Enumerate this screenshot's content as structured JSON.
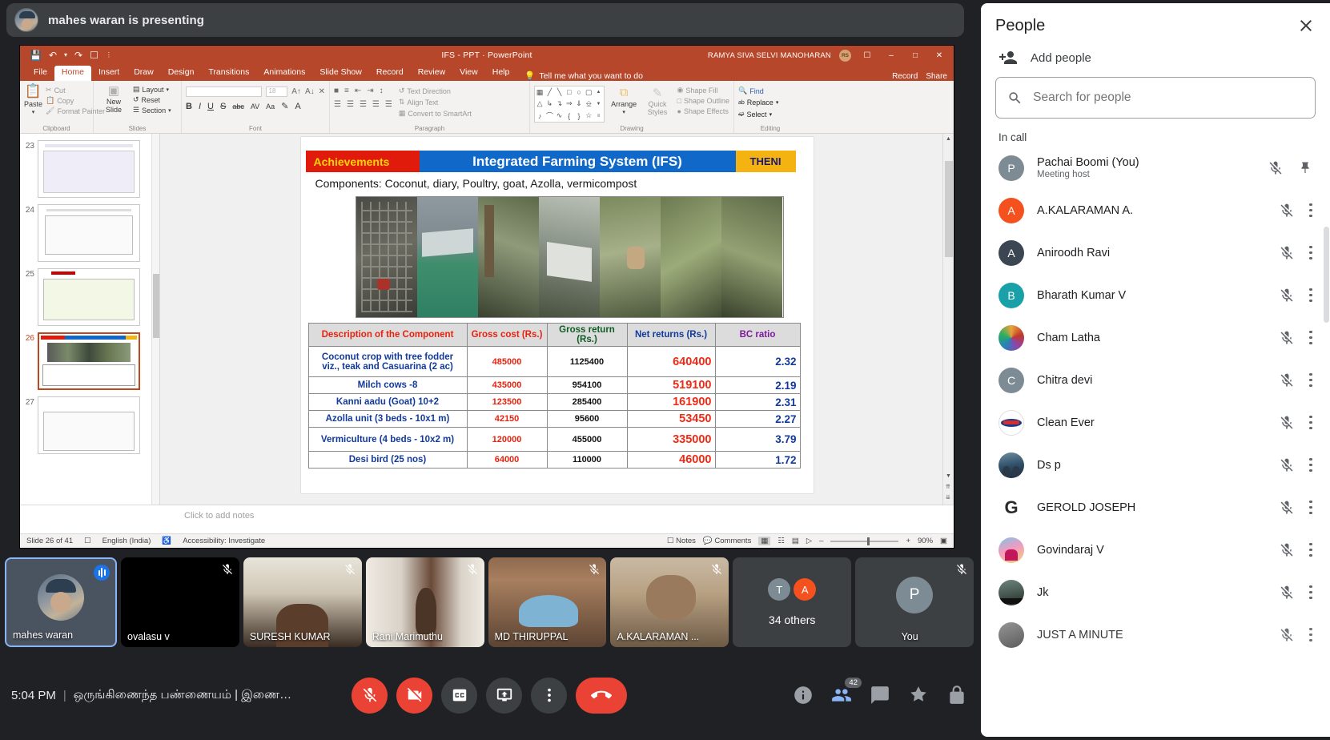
{
  "banner": {
    "text": "mahes waran is presenting"
  },
  "powerpoint": {
    "doc_title": "IFS - PPT  ·  PowerPoint",
    "user_name": "RAMYA SIVA SELVI MANOHARAN",
    "user_initials": "RS",
    "quick_access": [
      "save-icon",
      "undo-icon",
      "redo-icon",
      "present-icon",
      "more-icon"
    ],
    "window_buttons": [
      "minimize",
      "restore",
      "close"
    ],
    "tabs": [
      "File",
      "Home",
      "Insert",
      "Draw",
      "Design",
      "Transitions",
      "Animations",
      "Slide Show",
      "Record",
      "Review",
      "View",
      "Help"
    ],
    "active_tab": "Home",
    "tell_me": "Tell me what you want to do",
    "tabs_right": [
      "Record",
      "Share"
    ],
    "ribbon": {
      "clipboard": {
        "label": "Clipboard",
        "paste": "Paste",
        "cut": "Cut",
        "copy": "Copy",
        "format_painter": "Format Painter"
      },
      "slides": {
        "label": "Slides",
        "new_slide": "New Slide",
        "layout": "Layout",
        "reset": "Reset",
        "section": "Section"
      },
      "font": {
        "label": "Font",
        "font_name": "",
        "font_size": "18"
      },
      "paragraph": {
        "label": "Paragraph",
        "text_direction": "Text Direction",
        "align_text": "Align Text",
        "convert_smartart": "Convert to SmartArt"
      },
      "drawing": {
        "label": "Drawing",
        "arrange": "Arrange",
        "quick_styles": "Quick Styles",
        "shape_fill": "Shape Fill",
        "shape_outline": "Shape Outline",
        "shape_effects": "Shape Effects"
      },
      "editing": {
        "label": "Editing",
        "find": "Find",
        "replace": "Replace",
        "select": "Select"
      }
    },
    "thumbnails": [
      {
        "num": "23"
      },
      {
        "num": "24"
      },
      {
        "num": "25"
      },
      {
        "num": "26"
      },
      {
        "num": "27"
      }
    ],
    "selected_thumbnail": "26",
    "notes_placeholder": "Click to add notes",
    "status": {
      "slide_info": "Slide 26 of 41",
      "language": "English (India)",
      "accessibility": "Accessibility: Investigate",
      "notes_btn": "Notes",
      "comments_btn": "Comments",
      "zoom": "90%"
    },
    "slide": {
      "badge_left": "Achievements",
      "title": "Integrated Farming System (IFS)",
      "badge_right": "THENI",
      "subtitle": "Components: Coconut, diary, Poultry, goat, Azolla, vermicompost",
      "table": {
        "headers": [
          "Description of the Component",
          "Gross cost (Rs.)",
          "Gross return (Rs.)",
          "Net returns (Rs.)",
          "BC ratio"
        ],
        "rows": [
          {
            "desc": "Coconut crop with tree fodder viz., teak and Casuarina (2 ac)",
            "gross_cost": "485000",
            "gross_return": "1125400",
            "net_returns": "640400",
            "bc_ratio": "2.32"
          },
          {
            "desc": "Milch cows -8",
            "gross_cost": "435000",
            "gross_return": "954100",
            "net_returns": "519100",
            "bc_ratio": "2.19"
          },
          {
            "desc": "Kanni aadu (Goat) 10+2",
            "gross_cost": "123500",
            "gross_return": "285400",
            "net_returns": "161900",
            "bc_ratio": "2.31"
          },
          {
            "desc": "Azolla unit (3 beds - 10x1 m)",
            "gross_cost": "42150",
            "gross_return": "95600",
            "net_returns": "53450",
            "bc_ratio": "2.27"
          },
          {
            "desc": "Vermiculture (4 beds - 10x2 m)",
            "gross_cost": "120000",
            "gross_return": "455000",
            "net_returns": "335000",
            "bc_ratio": "3.79"
          },
          {
            "desc": "Desi bird  (25 nos)",
            "gross_cost": "64000",
            "gross_return": "110000",
            "net_returns": "46000",
            "bc_ratio": "1.72"
          }
        ]
      }
    }
  },
  "filmstrip": [
    {
      "name": "mahes waran",
      "muted": false,
      "speaking": true,
      "self": true,
      "kind": "video"
    },
    {
      "name": "ovalasu v",
      "muted": true,
      "kind": "black"
    },
    {
      "name": "SURESH KUMAR",
      "muted": true,
      "kind": "video"
    },
    {
      "name": "Rani Marimuthu",
      "muted": true,
      "kind": "video"
    },
    {
      "name": "MD THIRUPPAL",
      "muted": true,
      "kind": "video"
    },
    {
      "name": "A.KALARAMAN ...",
      "muted": true,
      "kind": "video"
    },
    {
      "name": "34 others",
      "kind": "others",
      "initials": [
        "T",
        "A"
      ]
    },
    {
      "name": "You",
      "muted": true,
      "kind": "avatar",
      "initial": "P"
    }
  ],
  "bottom": {
    "time": "5:04 PM",
    "separator": "|",
    "meeting_title": "ஒருங்கிணைந்த பண்ணையம் | இணை…",
    "controls": [
      "mic-off-button",
      "camera-off-button",
      "captions-button",
      "present-button",
      "more-options-button",
      "hang-up-button"
    ],
    "right_icons": [
      "meeting-details-icon",
      "people-icon",
      "chat-icon",
      "activities-icon",
      "host-controls-icon"
    ],
    "people_count": "42"
  },
  "people_panel": {
    "title": "People",
    "close_label": "close",
    "add_people": "Add people",
    "search_placeholder": "Search for people",
    "section_label": "In call",
    "participants": [
      {
        "name": "Pachai Boomi (You)",
        "sub": "Meeting host",
        "initial": "P",
        "color": "#7d8b94",
        "muted": true,
        "pinned": true
      },
      {
        "name": "A.KALARAMAN A.",
        "sub": "",
        "initial": "A",
        "color": "#f4511e",
        "muted": true
      },
      {
        "name": "Aniroodh Ravi",
        "sub": "",
        "initial": "A",
        "color": "#3c4653",
        "muted": true
      },
      {
        "name": "Bharath Kumar V",
        "sub": "",
        "initial": "B",
        "color": "#1aa0a8",
        "muted": true
      },
      {
        "name": "Cham Latha",
        "sub": "",
        "initial": "",
        "color": "#b7521f",
        "photo": true,
        "muted": true
      },
      {
        "name": "Chitra devi",
        "sub": "",
        "initial": "C",
        "color": "#7d8b94",
        "muted": true
      },
      {
        "name": "Clean Ever",
        "sub": "",
        "initial": "",
        "color": "#ffffff",
        "photo": true,
        "muted": true
      },
      {
        "name": "Ds p",
        "sub": "",
        "initial": "",
        "color": "#42606f",
        "photo": true,
        "muted": true
      },
      {
        "name": "GEROLD JOSEPH",
        "sub": "",
        "initial": "G",
        "color": "#ffffff",
        "photo": true,
        "muted": true
      },
      {
        "name": "Govindaraj V",
        "sub": "",
        "initial": "",
        "color": "#d86fa0",
        "photo": true,
        "muted": true
      },
      {
        "name": "Jk",
        "sub": "",
        "initial": "",
        "color": "#50605c",
        "photo": true,
        "muted": true
      },
      {
        "name": "JUST A MINUTE",
        "sub": "",
        "initial": "",
        "color": "#6b6b6b",
        "photo": true,
        "muted": true
      }
    ]
  }
}
